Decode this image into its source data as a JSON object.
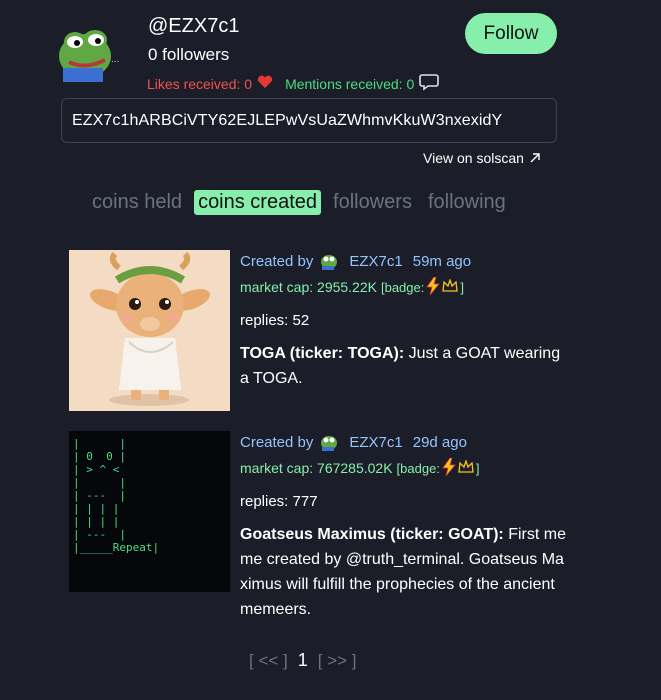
{
  "profile": {
    "handle": "@EZX7c1",
    "followers": "0 followers",
    "likes": "Likes received: 0",
    "mentions": "Mentions received: 0",
    "address": "EZX7c1hARBCiVTY62EJLEPwVsUaZWhmvKkuW3nxexidY",
    "solscan_label": "View on solscan",
    "follow_label": "Follow"
  },
  "tabs": [
    "coins held",
    "coins created",
    "followers",
    "following"
  ],
  "active_tab": "coins created",
  "coins": [
    {
      "created_by_label": "Created by",
      "creator": "EZX7c1",
      "age": "59m ago",
      "market_cap": "market cap: 2955.22K",
      "badge_open": "[badge:",
      "badge_close": "]",
      "replies": "replies: 52",
      "name": "TOGA (ticker: TOGA):",
      "description": " Just a GOAT wearing a TOGA."
    },
    {
      "created_by_label": "Created by",
      "creator": "EZX7c1",
      "age": "29d ago",
      "market_cap": "market cap: 767285.02K",
      "badge_open": "[badge:",
      "badge_close": "]",
      "replies": "replies: 777",
      "name": "Goatseus Maximus (ticker: GOAT):",
      "description": " First meme created by @truth_terminal. Goatseus Maximus will fulfill the prophecies of the ancient memeers.",
      "image_text": "|      |\n| 0  0 |\n| > ^ <\n|      |\n| ---  |\n| | | |\n| | | |\n| ---  |\n|_____Repeat|"
    }
  ],
  "pager": {
    "prev": "[ << ]",
    "current": "1",
    "next": "[ >> ]"
  },
  "colors": {
    "background": "#1b1d28",
    "accent_green": "#86efac",
    "likes_red": "#f05252",
    "link_blue": "#93c5fd"
  }
}
